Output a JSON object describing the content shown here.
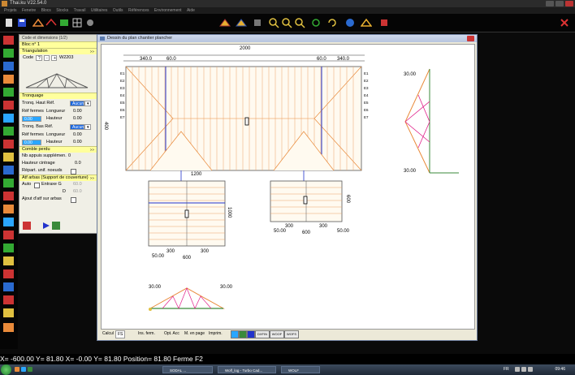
{
  "app": {
    "title": "Thai.ku  V22.54.0"
  },
  "menu": [
    "Projets",
    "Fenetre",
    "Blocs",
    "Stocks",
    "Travail",
    "Utilitaires",
    "Outils",
    "Références",
    "Environnement",
    "Aide"
  ],
  "panel": {
    "header": "Code et dimensions  (1/2)",
    "bloc": "Bloc n° 1",
    "triangulation": "Triangulation",
    "code_label": "Code",
    "code_value": "W2203",
    "tronquage": "Tronquage",
    "tronq_haut_label": "Tronq. Haut Réf.",
    "tronq_haut_value": "Aucun",
    "ref_fermes_label": "Réf fermes",
    "longueur_label": "Longueur",
    "hauteur_label": "Hauteur",
    "haut_longueur": "0.00",
    "haut_ref": "",
    "haut_hauteur": "0.00",
    "haut_ref2": "0.00",
    "tronq_bas_label": "Tronq. Bas Réf.",
    "tronq_bas_value": "Aucun",
    "bas_longueur": "0.00",
    "bas_ref": "",
    "bas_hauteur": "0.00",
    "bas_ref2": "0.00",
    "comble_perdu": "Comble perdu",
    "nb_appuis_label": "Nb appuis supplémen.",
    "nb_appuis_value": "0",
    "hauteur_cintrage_label": "Hauteur cintrage",
    "hauteur_cintrage_value": "0.0",
    "repart_label": "Répart. unif. noeuds",
    "atf_section": "Atf arbas (Support de couverture)",
    "auto_label": "Auto",
    "entraxe_label": "Entraxe G",
    "entraxe_value": "60.0",
    "d_label": "D",
    "d_value": "60.0",
    "ajout_label": "Ajout d'atf sur arbas"
  },
  "drawing": {
    "title": "Dessin du plan chantier plancher",
    "dims": {
      "total": "2000",
      "left_a": "340.0",
      "left_b": "60.0",
      "right_a": "60.0",
      "right_b": "340.0",
      "height": "400",
      "bottom_left": "1200",
      "ext_left_height": "1000",
      "ext_right_height": "600",
      "ext_left_a": "300",
      "ext_left_b": "300",
      "ext_left_c": "50.00",
      "ext_left_d": "600",
      "ext_right_a": "300",
      "ext_right_b": "300",
      "ext_right_c": "50.00",
      "ext_right_d": "600",
      "ext_right_e": "50.00",
      "truss_angle": "30.00",
      "truss_angle_r": "30.00",
      "truss_angle_bottom": "30.00"
    },
    "ferme_labels": [
      "E1",
      "E2",
      "E3",
      "E4",
      "E5",
      "E6",
      "E7",
      "E1",
      "E2",
      "E3",
      "E4",
      "E5",
      "E6",
      "E7"
    ]
  },
  "bottombar": {
    "calcul_label": "Calcul",
    "calcul_value": "FS",
    "ins_ferm": "Ins. ferm.",
    "opt_acc": "Opt. Acc",
    "mise_en_page": "M. en page",
    "imprim": "Imprim.",
    "btn1": "DXFIN",
    "btn2": "WOOF",
    "btn3": "WOFS"
  },
  "status": {
    "text": "X= -600.00 Y=   81.80 X=   -0.00 Y=   81.80 Position=   81.80 Ferme F2"
  },
  "taskbar": {
    "items": [
      "SODAL ...",
      "Wolf_log - Turbo Cad...",
      "WOLF"
    ],
    "lang": "FR",
    "clock": "09:46"
  },
  "colors": {
    "accent_yellow": "#ffff9c",
    "highlight_blue": "#2aa6ff",
    "truss_orange": "#e98a3a",
    "beam_blue": "#2233cc",
    "truss_pink": "#e0208a"
  },
  "icons": [
    "save-icon",
    "open-icon",
    "print-icon",
    "zoom-in-icon",
    "zoom-out-icon",
    "zoom-fit-icon",
    "grid-icon",
    "layers-icon",
    "settings-icon",
    "help-icon",
    "close-icon"
  ]
}
